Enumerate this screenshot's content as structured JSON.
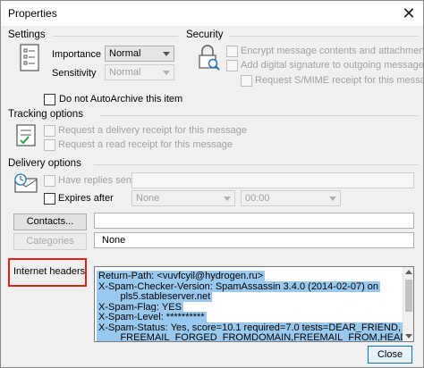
{
  "window": {
    "title": "Properties",
    "close_glyph": "✕"
  },
  "settings": {
    "heading": "Settings",
    "importance_label": "Importance",
    "importance_value": "Normal",
    "sensitivity_label": "Sensitivity",
    "sensitivity_value": "Normal",
    "autoarchive_label": "Do not AutoArchive this item",
    "icon": "document-list-icon"
  },
  "security": {
    "heading": "Security",
    "encrypt_label": "Encrypt message contents and attachments",
    "signature_label": "Add digital signature to outgoing message",
    "smime_label": "Request S/MIME receipt for this message",
    "icon": "lock-magnifier-icon"
  },
  "tracking": {
    "heading": "Tracking options",
    "delivery_receipt_label": "Request a delivery receipt for this message",
    "read_receipt_label": "Request a read receipt for this message",
    "icon": "checklist-icon"
  },
  "delivery": {
    "heading": "Delivery options",
    "replies_label": "Have replies sent to",
    "expires_label": "Expires after",
    "expires_date": "None",
    "expires_time": "00:00",
    "icon": "clock-envelope-icon"
  },
  "contacts": {
    "button_label": "Contacts...",
    "value": ""
  },
  "categories": {
    "button_label": "Categories",
    "value": "None"
  },
  "internet_headers": {
    "label": "Internet headers",
    "lines": [
      "Return-Path: <vuvfcyil@hydrogen.ru>",
      "X-Spam-Checker-Version: SpamAssassin 3.4.0 (2014-02-07) on",
      "        pls5.stableserver.net",
      "X-Spam-Flag: YES",
      "X-Spam-Level: **********",
      "X-Spam-Status: Yes, score=10.1 required=7.0 tests=DEAR_FRIEND,",
      "        FREEMAIL_FORGED_FROMDOMAIN,FREEMAIL_FROM,HEADER_FR"
    ]
  },
  "footer": {
    "close_label": "Close"
  },
  "colors": {
    "highlight": "#99c9ef",
    "annotation_box": "#e0201b",
    "accent": "#0078d7"
  }
}
